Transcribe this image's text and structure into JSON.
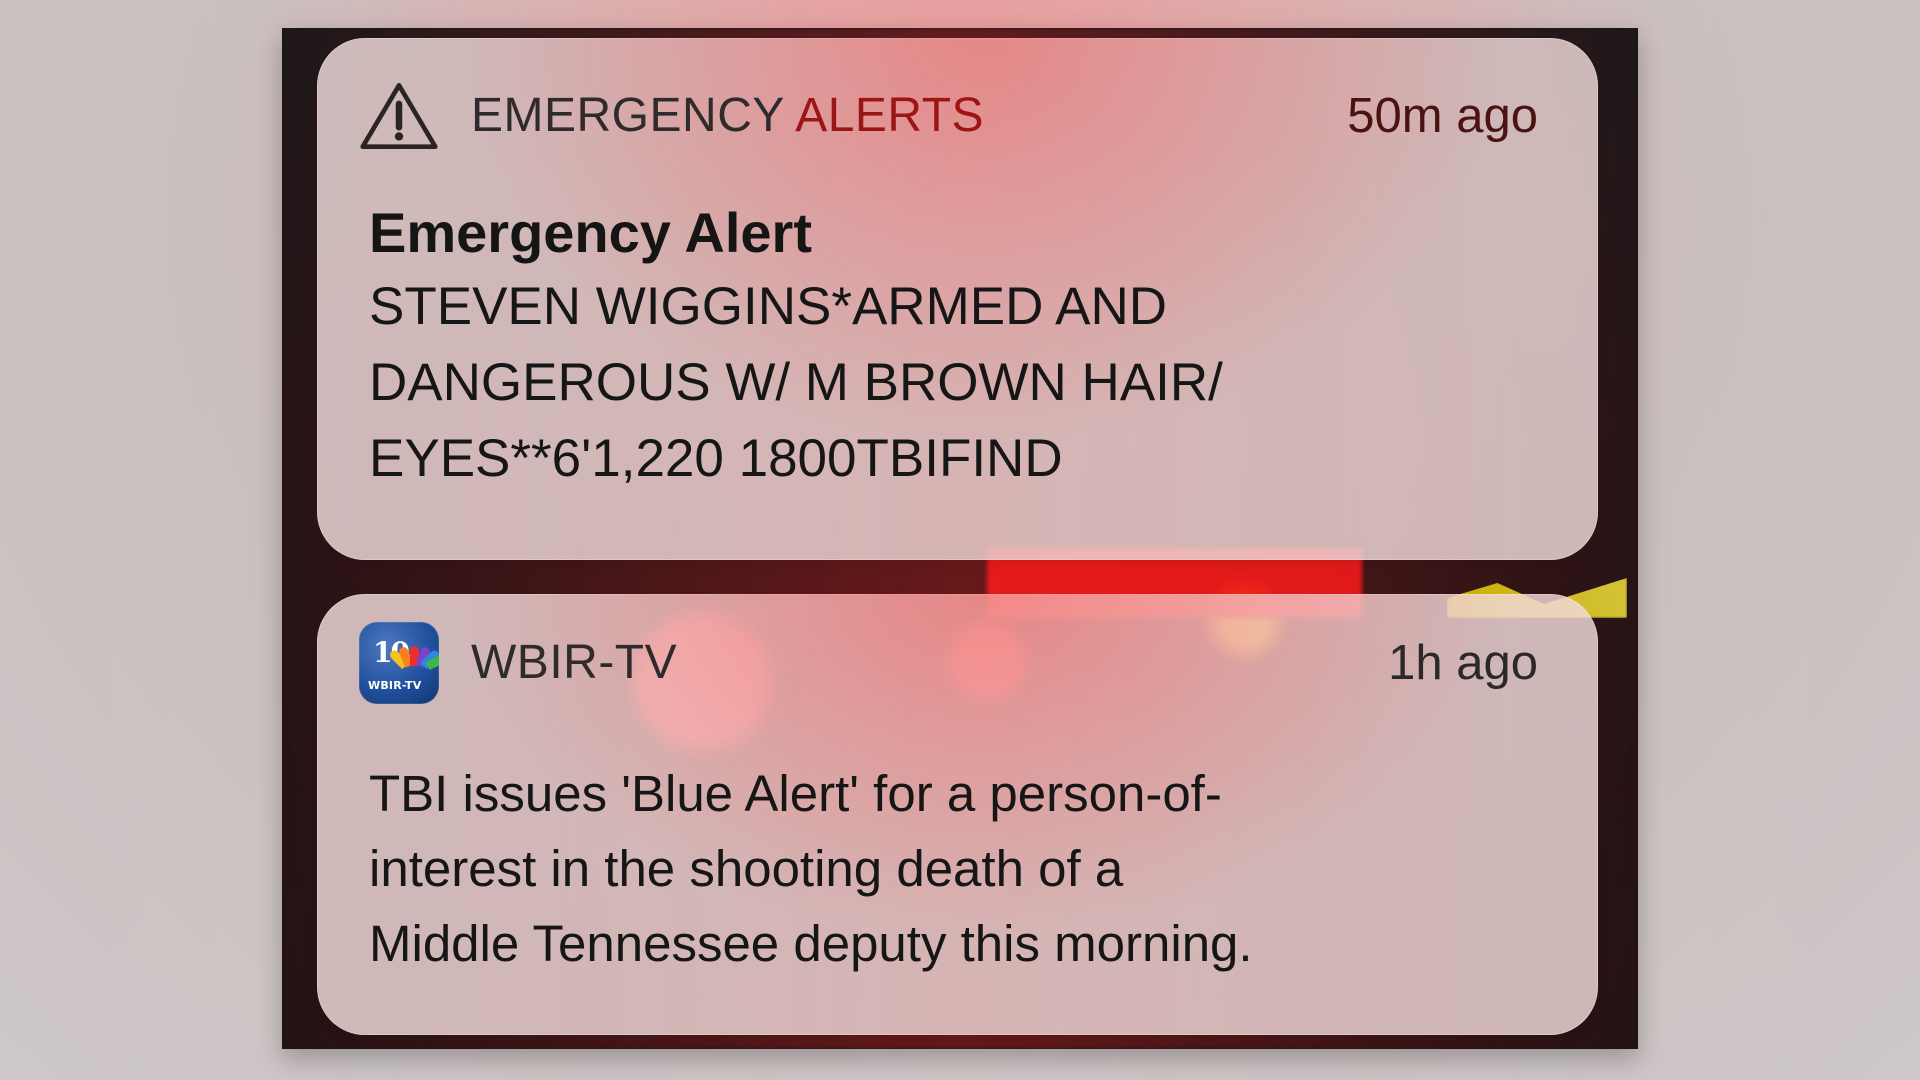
{
  "notifications": [
    {
      "app_name_prefix": "EMERGENCY ",
      "app_name_alert": "ALERTS",
      "time": "50m ago",
      "title": "Emergency Alert",
      "message": "STEVEN WIGGINS*ARMED AND\nDANGEROUS W/ M BROWN HAIR/\nEYES**6'1,220 1800TBIFIND",
      "icon": "warning-triangle-icon"
    },
    {
      "app_name": "WBIR-TV",
      "time": "1h ago",
      "message": "TBI issues 'Blue Alert' for a person-of-\ninterest in the shooting death of a\nMiddle Tennessee deputy this morning.",
      "icon": "wbir-tv-app-icon",
      "icon_text_top": "10",
      "icon_text_bottom": "WBIR-TV"
    }
  ],
  "colors": {
    "alert_red": "#9b1515",
    "time_red": "#4b1212",
    "text_dark": "#161616",
    "wbir_blue": "#1f4f9d"
  }
}
